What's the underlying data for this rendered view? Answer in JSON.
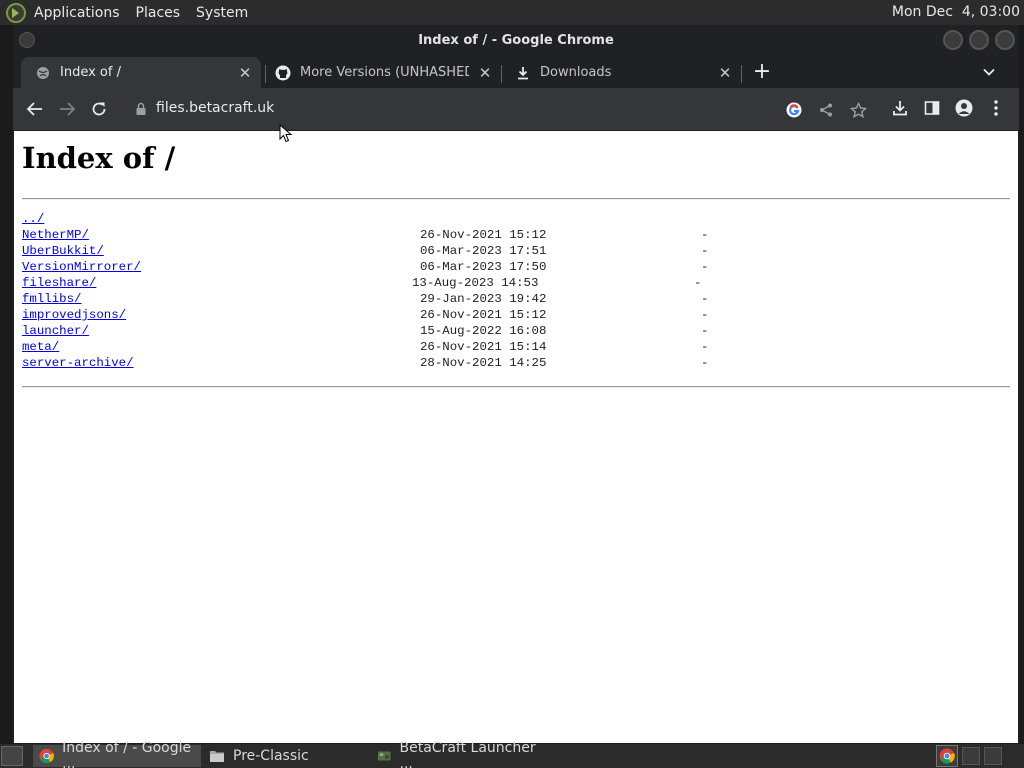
{
  "top_panel": {
    "menus": [
      "Applications",
      "Places",
      "System"
    ],
    "clock": "Mon Dec  4, 03:00"
  },
  "window": {
    "title": "Index of / - Google Chrome"
  },
  "tabs": [
    {
      "title": "Index of /",
      "icon": "globe-icon",
      "active": true
    },
    {
      "title": "More Versions (UNHASHED) ·",
      "icon": "github-icon",
      "active": false
    },
    {
      "title": "Downloads",
      "icon": "download-icon",
      "active": false
    }
  ],
  "toolbar": {
    "url": "files.betacraft.uk"
  },
  "page": {
    "heading": "Index of /",
    "parent_link": "../",
    "entries": [
      {
        "name": "NetherMP/",
        "date": "26-Nov-2021 15:12",
        "size": "-"
      },
      {
        "name": "UberBukkit/",
        "date": "06-Mar-2023 17:51",
        "size": "-"
      },
      {
        "name": "VersionMirrorer/",
        "date": "06-Mar-2023 17:50",
        "size": "-"
      },
      {
        "name": "fileshare/",
        "date": "13-Aug-2023 14:53",
        "size": "-"
      },
      {
        "name": "fmllibs/",
        "date": "29-Jan-2023 19:42",
        "size": "-"
      },
      {
        "name": "improvedjsons/",
        "date": "26-Nov-2021 15:12",
        "size": "-"
      },
      {
        "name": "launcher/",
        "date": "15-Aug-2022 16:08",
        "size": "-"
      },
      {
        "name": "meta/",
        "date": "26-Nov-2021 15:14",
        "size": "-"
      },
      {
        "name": "server-archive/",
        "date": "28-Nov-2021 14:25",
        "size": "-"
      }
    ]
  },
  "taskbar": {
    "tasks": [
      {
        "label": "Index of / - Google ...",
        "icon": "chrome-icon",
        "active": true
      },
      {
        "label": "Pre-Classic",
        "icon": "folder-icon",
        "active": false
      },
      {
        "label": "BetaCraft Launcher ...",
        "icon": "betacraft-icon",
        "active": false
      }
    ]
  },
  "colors": {
    "link": "#0000ee",
    "panel_bg": "#2c2c2c",
    "chrome_frame": "#202124",
    "chrome_toolbar": "#35363a"
  }
}
